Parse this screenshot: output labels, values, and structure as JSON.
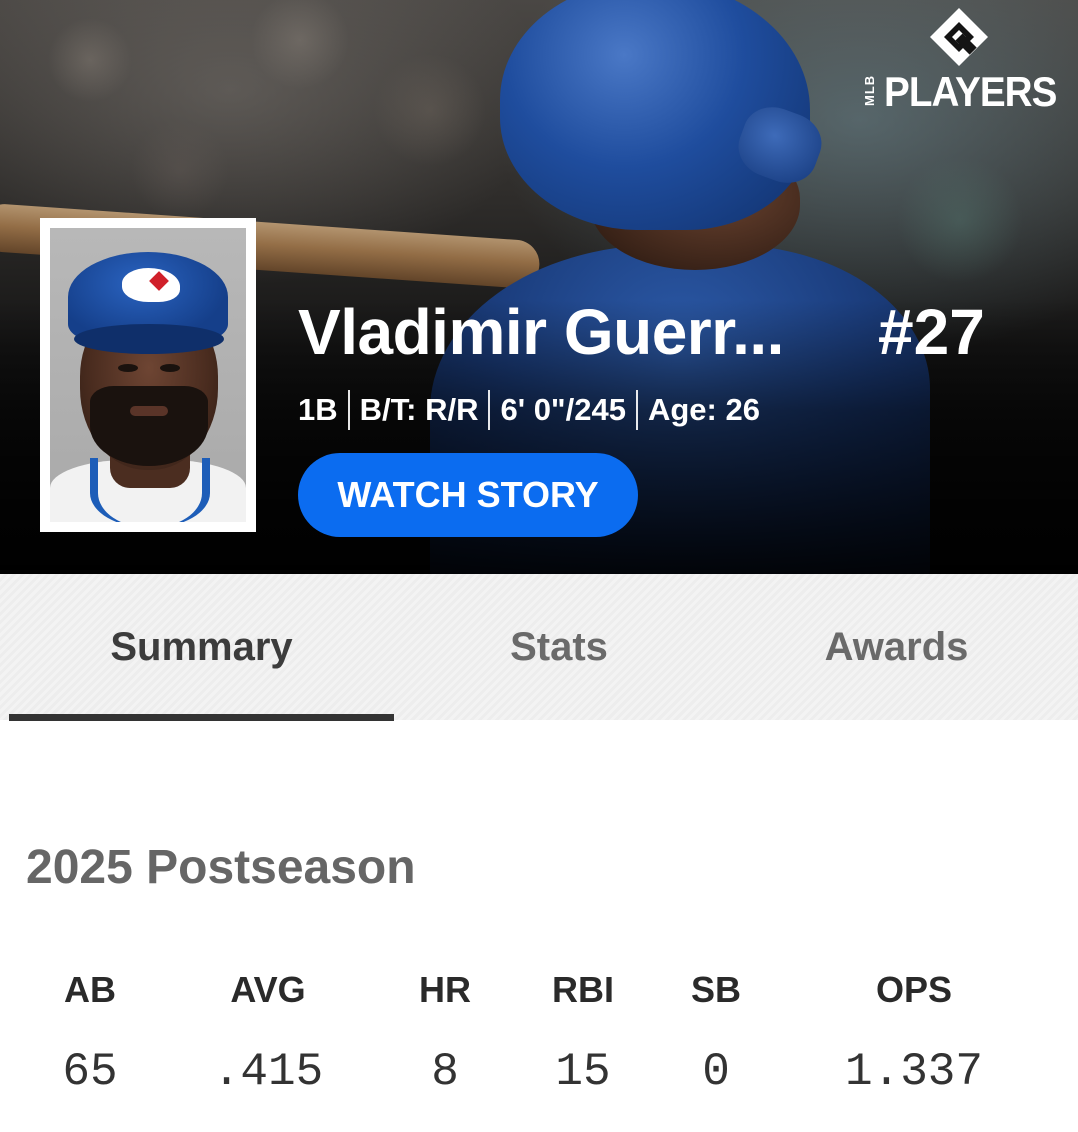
{
  "brand": {
    "logo_text": "PLAYERS",
    "logo_prefix": "MLB",
    "logo_icon": "mlbpa-diamond-icon"
  },
  "player": {
    "name": "Vladimir Guerr...",
    "number": "#27",
    "position": "1B",
    "bats_throws": "B/T: R/R",
    "height_weight": "6' 0\"/245",
    "age": "Age: 26",
    "watch_story_label": "WATCH STORY"
  },
  "tabs": [
    {
      "label": "Summary",
      "active": true
    },
    {
      "label": "Stats",
      "active": false
    },
    {
      "label": "Awards",
      "active": false
    }
  ],
  "postseason": {
    "title": "2025 Postseason",
    "stats": [
      {
        "label": "AB",
        "value": "65"
      },
      {
        "label": "AVG",
        "value": ".415"
      },
      {
        "label": "HR",
        "value": "8"
      },
      {
        "label": "RBI",
        "value": "15"
      },
      {
        "label": "SB",
        "value": "0"
      },
      {
        "label": "OPS",
        "value": "1.337"
      }
    ]
  },
  "colors": {
    "accent": "#0b6cf0",
    "tab_indicator": "#333333",
    "team_blue": "#1d5db8"
  }
}
